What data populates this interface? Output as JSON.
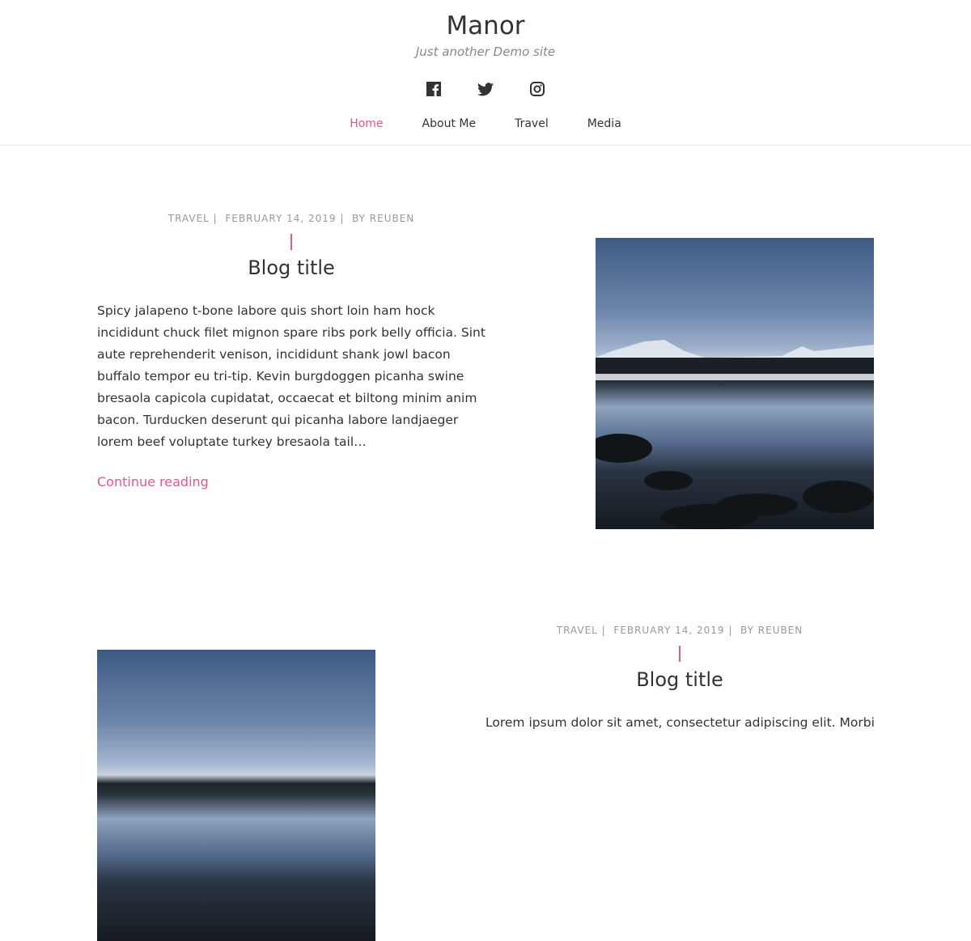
{
  "site": {
    "title": "Manor",
    "tagline": "Just another Demo site"
  },
  "social": [
    "facebook-icon",
    "twitter-icon",
    "instagram-icon"
  ],
  "nav": [
    {
      "label": "Home",
      "active": true
    },
    {
      "label": "About Me"
    },
    {
      "label": "Travel"
    },
    {
      "label": "Media"
    }
  ],
  "accent": "#e0588c",
  "posts": [
    {
      "category": "TRAVEL",
      "date": "FEBRUARY 14, 2019",
      "author": "BY REUBEN",
      "title": "Blog title",
      "excerpt": "Spicy jalapeno t-bone labore quis short loin ham hock incididunt chuck filet mignon spare ribs pork belly officia. Sint aute reprehenderit venison, incididunt shank jowl bacon buffalo tempor eu tri-tip. Kevin burgdoggen picanha swine bresaola capicola cupidatat, occaecat et biltong minim anim bacon. Turducken deserunt qui picanha labore landjaeger lorem beef voluptate turkey bresaola tail…",
      "more": "Continue reading"
    },
    {
      "category": "TRAVEL",
      "date": "FEBRUARY 14, 2019",
      "author": "BY REUBEN",
      "title": "Blog title",
      "excerpt": "Lorem ipsum dolor sit amet, consectetur adipiscing elit. Morbi"
    }
  ]
}
